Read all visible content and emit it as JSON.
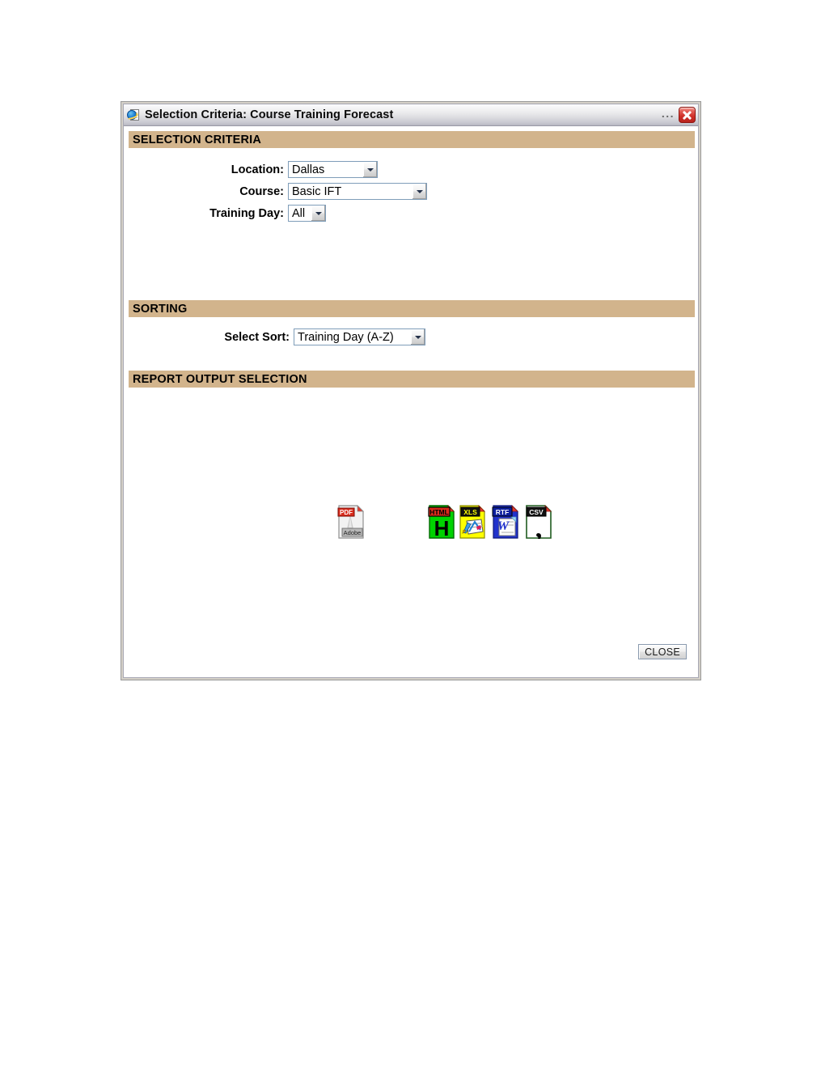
{
  "window": {
    "title": "Selection Criteria: Course Training Forecast",
    "app_icon": "internet-explorer-icon",
    "overflow_dots": "...",
    "close_icon": "close-icon"
  },
  "sections": {
    "selection_criteria_header": "SELECTION CRITERIA",
    "sorting_header": "SORTING",
    "report_output_header": "REPORT OUTPUT SELECTION"
  },
  "form": {
    "location": {
      "label": "Location:",
      "value": "Dallas",
      "options": [
        "Dallas"
      ]
    },
    "course": {
      "label": "Course:",
      "value": "Basic IFT",
      "options": [
        "Basic IFT"
      ]
    },
    "training_day": {
      "label": "Training Day:",
      "value": "All",
      "options": [
        "All"
      ]
    }
  },
  "sorting": {
    "select_sort": {
      "label": "Select Sort:",
      "value": "Training Day (A-Z)",
      "options": [
        "Training Day (A-Z)"
      ]
    }
  },
  "report_output": {
    "formats": [
      {
        "id": "pdf",
        "icon": "pdf-file-icon",
        "label": "PDF",
        "sub_label": "Adobe"
      },
      {
        "id": "html",
        "icon": "html-file-icon",
        "label": "HTML",
        "sub_label": "H"
      },
      {
        "id": "xls",
        "icon": "xls-file-icon",
        "label": "XLS",
        "sub_label": ""
      },
      {
        "id": "rtf",
        "icon": "rtf-file-icon",
        "label": "RTF",
        "sub_label": "W"
      },
      {
        "id": "csv",
        "icon": "csv-file-icon",
        "label": "CSV",
        "sub_label": ","
      }
    ]
  },
  "footer": {
    "close_label": "CLOSE"
  },
  "colors": {
    "section_header_bg": "#d2b48c",
    "select_border": "#7f9db9",
    "close_button_red": "#cf2f28",
    "window_border": "#9a9a9a",
    "page_background": "#ffffff"
  }
}
